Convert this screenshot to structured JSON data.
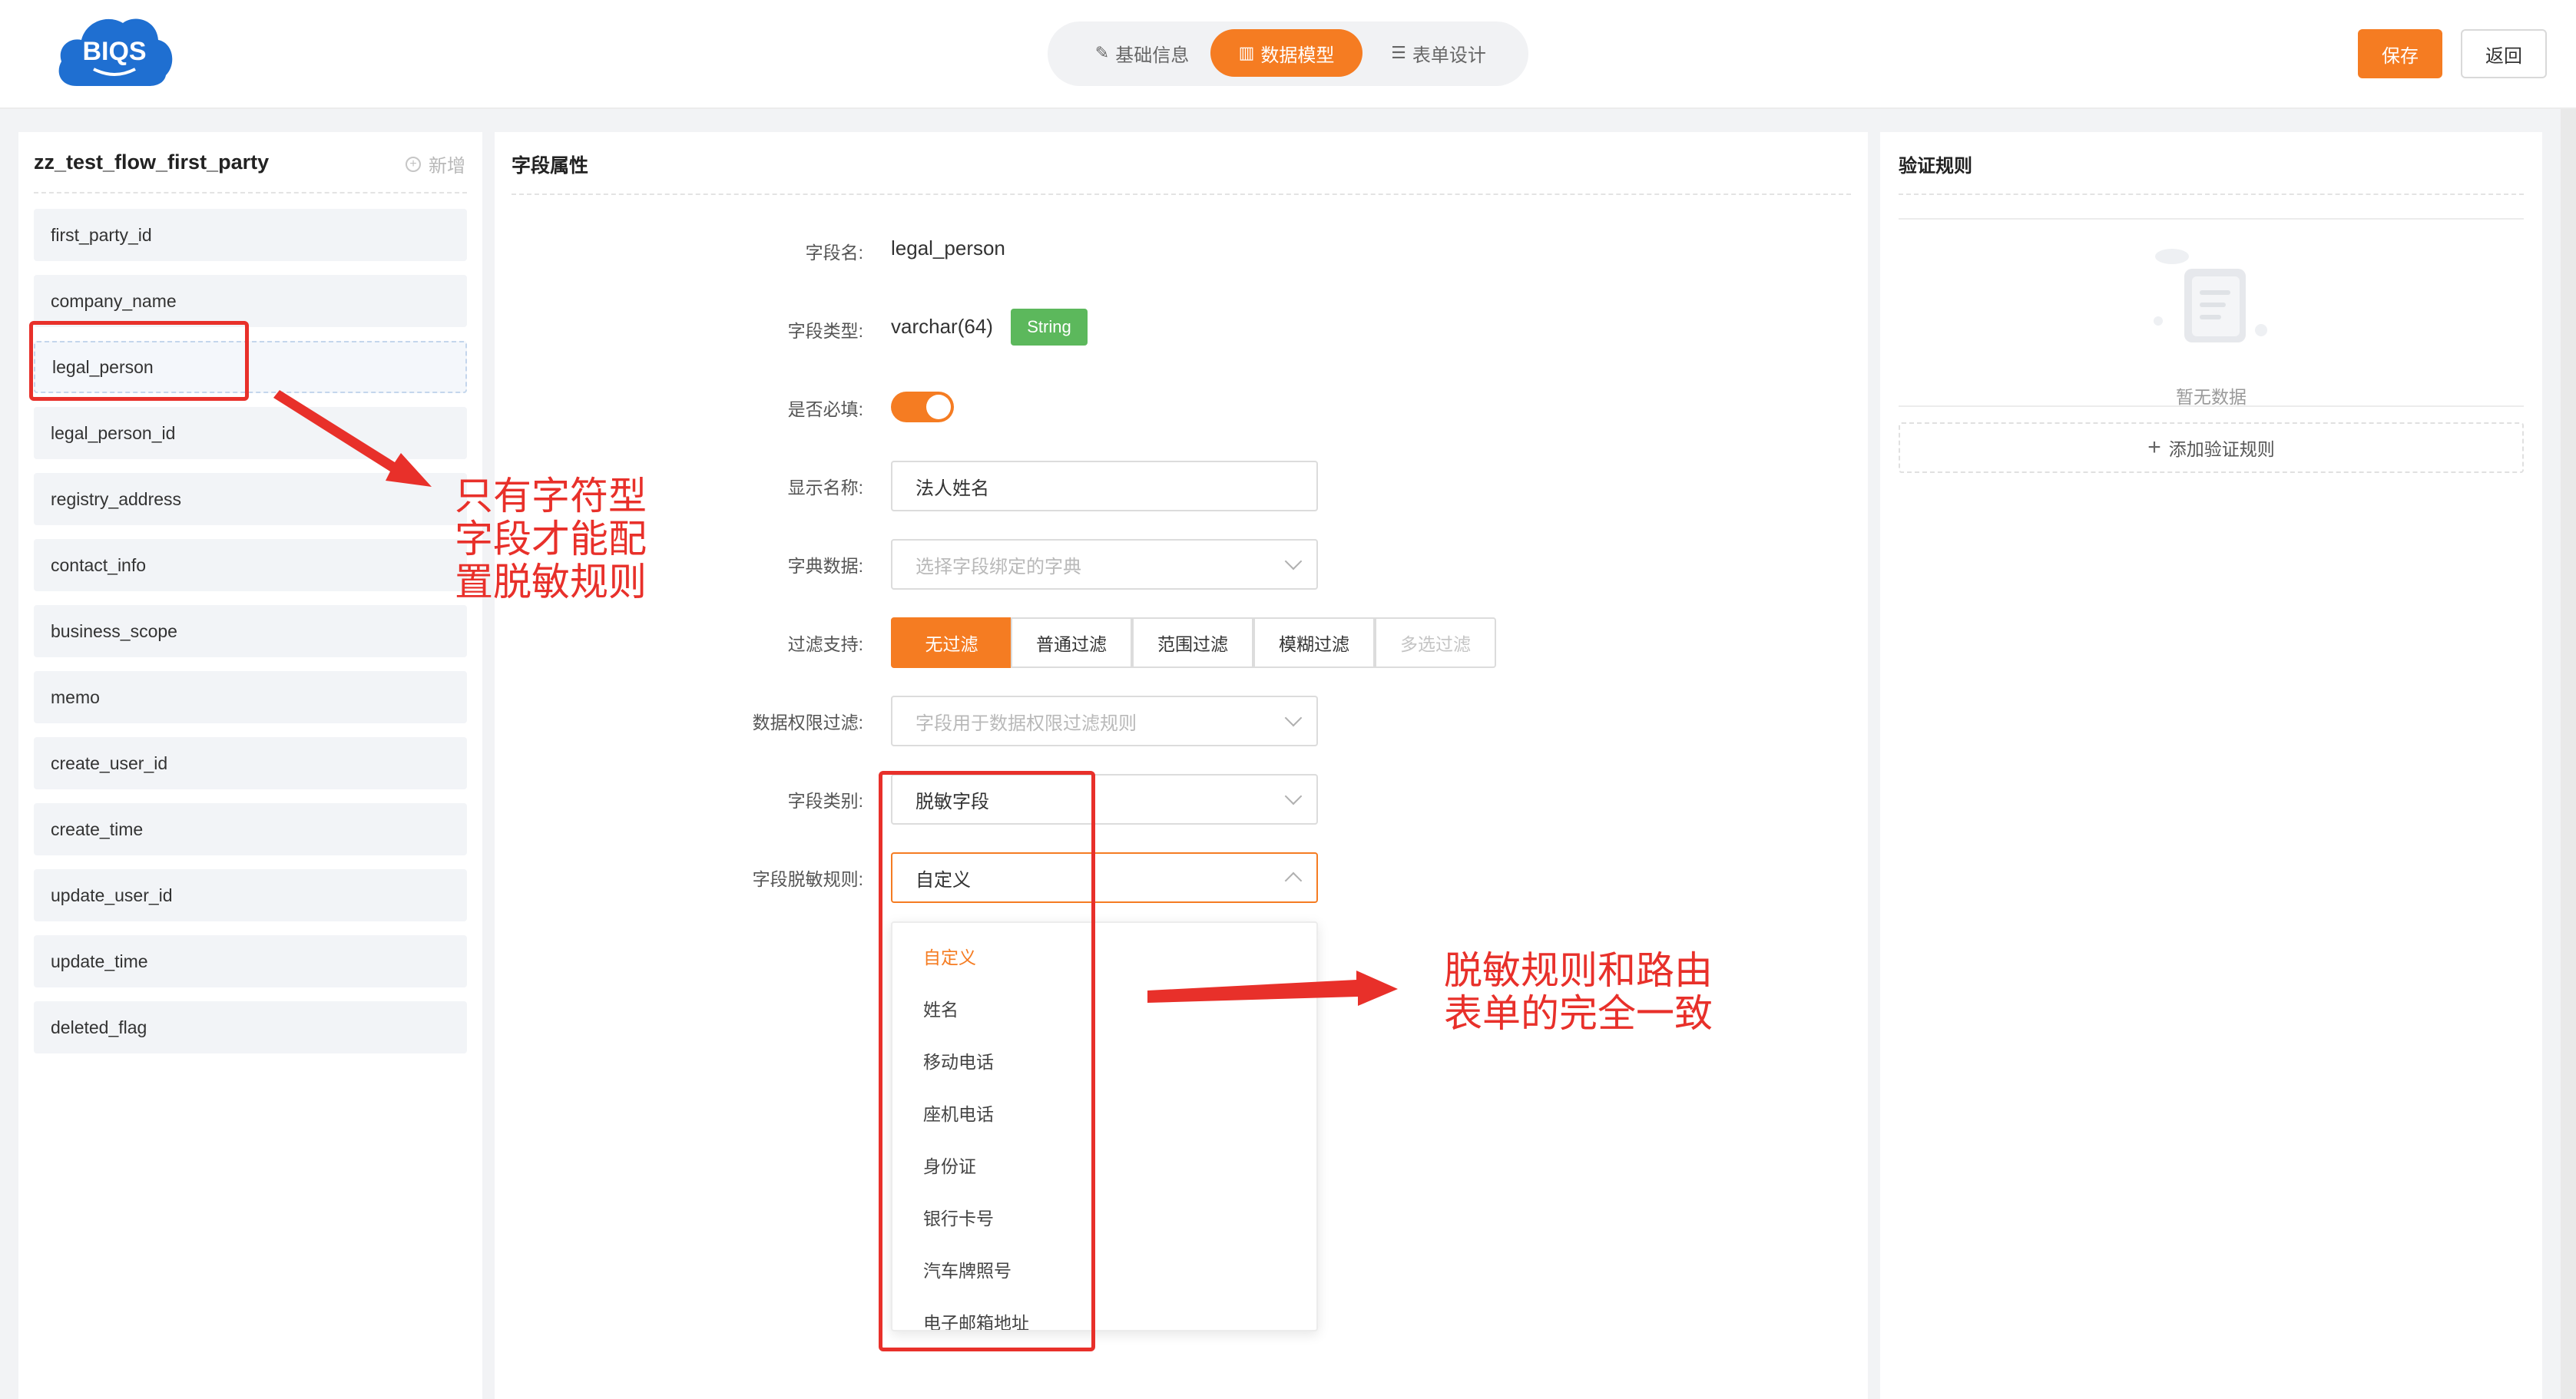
{
  "header": {
    "logo_text": "BIQS",
    "steps": [
      {
        "label": "基础信息",
        "icon": "doc-edit-icon",
        "active": false
      },
      {
        "label": "数据模型",
        "icon": "bar-chart-icon",
        "active": true
      },
      {
        "label": "表单设计",
        "icon": "doc-list-icon",
        "active": false
      }
    ],
    "save_label": "保存",
    "back_label": "返回"
  },
  "left": {
    "title": "zz_test_flow_first_party",
    "add_label": "新增",
    "fields": [
      "first_party_id",
      "company_name",
      "legal_person",
      "legal_person_id",
      "registry_address",
      "contact_info",
      "business_scope",
      "memo",
      "create_user_id",
      "create_time",
      "update_user_id",
      "update_time",
      "deleted_flag"
    ],
    "selected_field": "legal_person"
  },
  "mid": {
    "title": "字段属性",
    "field_name_label": "字段名:",
    "field_name_value": "legal_person",
    "field_type_label": "字段类型:",
    "field_type_value": "varchar(64)",
    "field_type_tag": "String",
    "required_label": "是否必填:",
    "required_on": true,
    "display_name_label": "显示名称:",
    "display_name_value": "法人姓名",
    "dict_label": "字典数据:",
    "dict_placeholder": "选择字段绑定的字典",
    "filter_label": "过滤支持:",
    "filter_options": [
      "无过滤",
      "普通过滤",
      "范围过滤",
      "模糊过滤",
      "多选过滤"
    ],
    "filter_selected": "无过滤",
    "perm_label": "数据权限过滤:",
    "perm_placeholder": "字段用于数据权限过滤规则",
    "category_label": "字段类别:",
    "category_value": "脱敏字段",
    "mask_label": "字段脱敏规则:",
    "mask_value": "自定义",
    "mask_options": [
      "自定义",
      "姓名",
      "移动电话",
      "座机电话",
      "身份证",
      "银行卡号",
      "汽车牌照号",
      "电子邮箱地址"
    ]
  },
  "right": {
    "title": "验证规则",
    "empty_text": "暂无数据",
    "add_rule_label": "添加验证规则"
  },
  "annotations": {
    "note1": [
      "只有字符型",
      "字段才能配",
      "置脱敏规则"
    ],
    "note2": [
      "脱敏规则和路由",
      "表单的完全一致"
    ],
    "color": "#e8302a"
  },
  "colors": {
    "accent": "#f57c22",
    "tag_green": "#5cb85c",
    "logo_blue": "#1f6fd1"
  }
}
